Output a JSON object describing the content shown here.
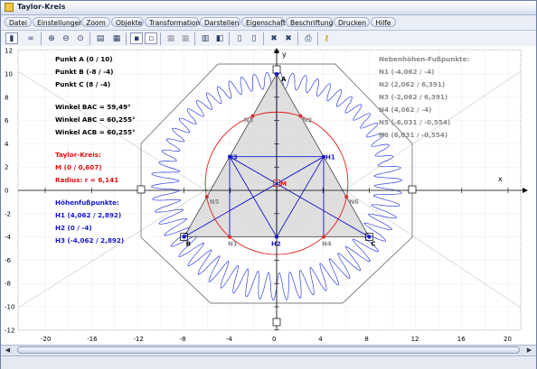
{
  "window": {
    "title": "Taylor-Kreis"
  },
  "menu": [
    "Datei",
    "Einstellungen",
    "Zoom",
    "Objekte",
    "Transformation",
    "Darstellen",
    "Eigenschaft",
    "Beschriftung",
    "Drucken",
    "Hilfe"
  ],
  "toolbar_icons": [
    "select-tool-icon",
    "link-icon",
    "zoom-in-icon",
    "zoom-out-icon",
    "zoom-fit-icon",
    "window-icon",
    "layer-icon",
    "grid-toggle-icon",
    "snap-grid-icon",
    "axes-toggle-icon",
    "ruler-icon",
    "table-icon",
    "save-icon",
    "copy-icon",
    "cut-icon",
    "delete-icon",
    "print-icon",
    "help-key-icon"
  ],
  "axes": {
    "x_label": "x",
    "y_label": "y",
    "x_ticks": [
      "-20",
      "-16",
      "-12",
      "-8",
      "-4",
      "0",
      "4",
      "8",
      "12",
      "16",
      "20"
    ],
    "y_ticks": [
      "12",
      "10",
      "8",
      "6",
      "4",
      "2",
      "0",
      "-2",
      "-4",
      "-6",
      "-8",
      "-10",
      "-12"
    ]
  },
  "points_panel": {
    "lines": [
      "Punkt A (0 / 10)",
      "Punkt B (-8 / -4)",
      "Punkt C (8 / -4)"
    ]
  },
  "angles_panel": {
    "lines": [
      "Winkel BAC = 59,49°",
      "Winkel ABC = 60,255°",
      "Winkel ACB = 60,255°"
    ]
  },
  "taylor_panel": {
    "lines": [
      "Taylor-Kreis:",
      "M (0 / 0,607)",
      "Radius: r = 6,141"
    ]
  },
  "heights_panel": {
    "lines": [
      "Höhenfußpunkte:",
      "H1 (4,062 / 2,892)",
      "H2 (0 / -4)",
      "H3 (-4,062 / 2,892)"
    ]
  },
  "feet_panel": {
    "lines": [
      "Nebenhöhen-Fußpunkte:",
      "N1 (-4,062 / -4)",
      "N2 (2,062 / 6,391)",
      "N3 (-2,062 / 6,391)",
      "N4 (4,062 / -4)",
      "N5 (-6,031 / -0,554)",
      "N6 (6,031 / -0,554)"
    ]
  },
  "point_labels": {
    "A": "A",
    "B": "B",
    "C": "C",
    "M": "M",
    "H1": "H1",
    "H2": "H2",
    "H3": "H3",
    "N1": "N1",
    "N2": "N2",
    "N3": "N3",
    "N4": "N4",
    "N5": "N5",
    "N6": "N6"
  },
  "geometry": {
    "A": [
      0,
      10
    ],
    "B": [
      -8,
      -4
    ],
    "C": [
      8,
      -4
    ],
    "M": [
      0,
      0.607
    ],
    "radius": 6.141,
    "H1": [
      4.062,
      2.892
    ],
    "H2": [
      0,
      -4
    ],
    "H3": [
      -4.062,
      2.892
    ],
    "N1": [
      -4.062,
      -4
    ],
    "N2": [
      2.062,
      6.391
    ],
    "N3": [
      -2.062,
      6.391
    ],
    "N4": [
      4.062,
      -4
    ],
    "N5": [
      -6.031,
      -0.554
    ],
    "N6": [
      6.031,
      -0.554
    ]
  },
  "colors": {
    "text_black": "#000000",
    "taylor_red": "#e01010",
    "heights_blue": "#1616c8",
    "feet_gray": "#8a8a8a",
    "circle_red": "#e02020",
    "curve_blue": "#3344dd",
    "triangle_fill": "#d9d9d9",
    "axis": "#000000"
  }
}
